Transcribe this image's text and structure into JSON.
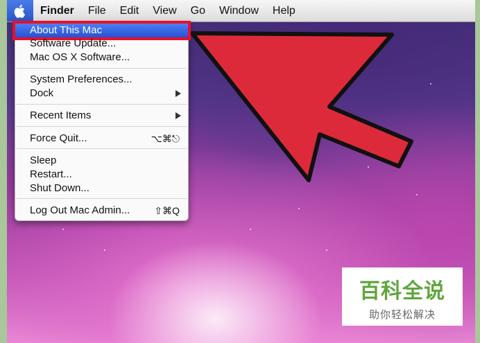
{
  "menubar": {
    "apple_icon": "apple-logo-icon",
    "items": [
      {
        "label": "Finder",
        "bold": true
      },
      {
        "label": "File"
      },
      {
        "label": "Edit"
      },
      {
        "label": "View"
      },
      {
        "label": "Go"
      },
      {
        "label": "Window"
      },
      {
        "label": "Help"
      }
    ]
  },
  "apple_menu": {
    "items": {
      "about": {
        "label": "About This Mac",
        "highlighted": true
      },
      "software_update": {
        "label": "Software Update..."
      },
      "mac_os_x_software": {
        "label": "Mac OS X Software..."
      },
      "system_preferences": {
        "label": "System Preferences..."
      },
      "dock": {
        "label": "Dock",
        "submenu": true
      },
      "recent_items": {
        "label": "Recent Items",
        "submenu": true
      },
      "force_quit": {
        "label": "Force Quit...",
        "shortcut": "⌥⌘⎋"
      },
      "sleep": {
        "label": "Sleep"
      },
      "restart": {
        "label": "Restart..."
      },
      "shut_down": {
        "label": "Shut Down..."
      },
      "log_out": {
        "label": "Log Out Mac Admin...",
        "shortcut": "⇧⌘Q"
      }
    }
  },
  "colors": {
    "highlight": "#2f5fe0",
    "callout_red": "#e8102a",
    "arrow_red": "#dd2a3a",
    "watermark_green": "#5fa63d"
  },
  "watermark": {
    "title": "百科全说",
    "subtitle": "助你轻松解决"
  }
}
